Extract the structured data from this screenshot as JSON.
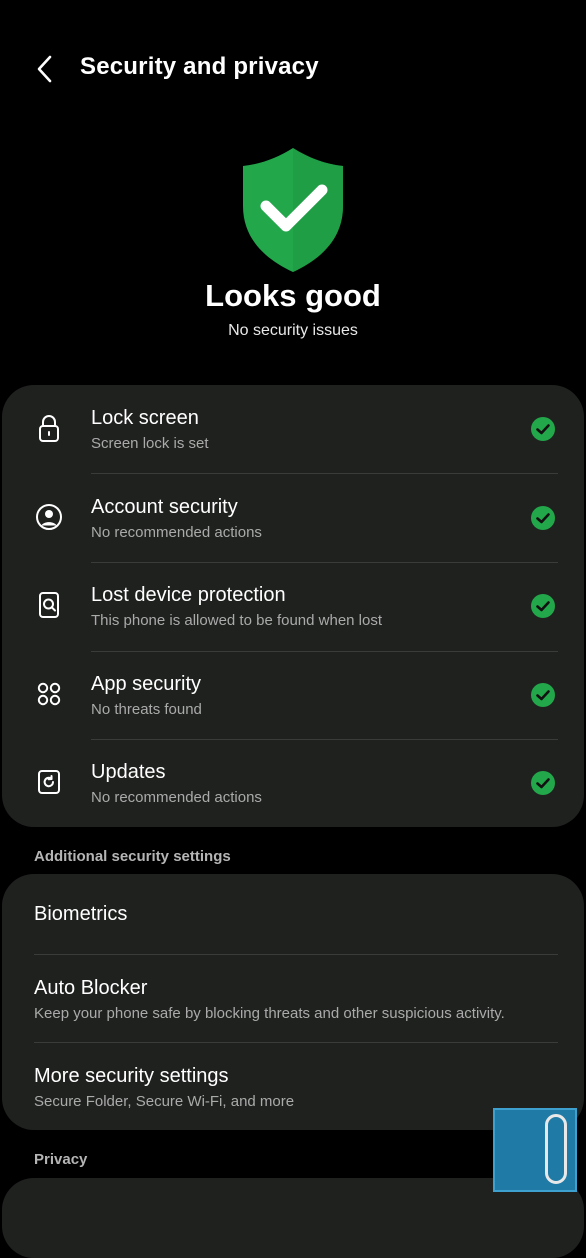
{
  "header": {
    "title": "Security and privacy"
  },
  "hero": {
    "title": "Looks good",
    "subtitle": "No security issues"
  },
  "status_items": [
    {
      "label": "Lock screen",
      "sub": "Screen lock is set",
      "icon": "lock-icon"
    },
    {
      "label": "Account security",
      "sub": "No recommended actions",
      "icon": "account-icon"
    },
    {
      "label": "Lost device protection",
      "sub": "This phone is allowed to be found when lost",
      "icon": "find-device-icon"
    },
    {
      "label": "App security",
      "sub": "No threats found",
      "icon": "apps-icon"
    },
    {
      "label": "Updates",
      "sub": "No recommended actions",
      "icon": "update-icon"
    }
  ],
  "additional": {
    "section_title": "Additional security settings",
    "items": [
      {
        "label": "Biometrics"
      },
      {
        "label": "Auto Blocker",
        "sub": "Keep your phone safe by blocking threats and other suspicious activity."
      },
      {
        "label": "More security settings",
        "sub": "Secure Folder, Secure Wi-Fi, and more"
      }
    ]
  },
  "privacy": {
    "section_title": "Privacy"
  },
  "colors": {
    "accent_green": "#22a74b",
    "card_bg": "#1f211f",
    "background": "#000000"
  }
}
